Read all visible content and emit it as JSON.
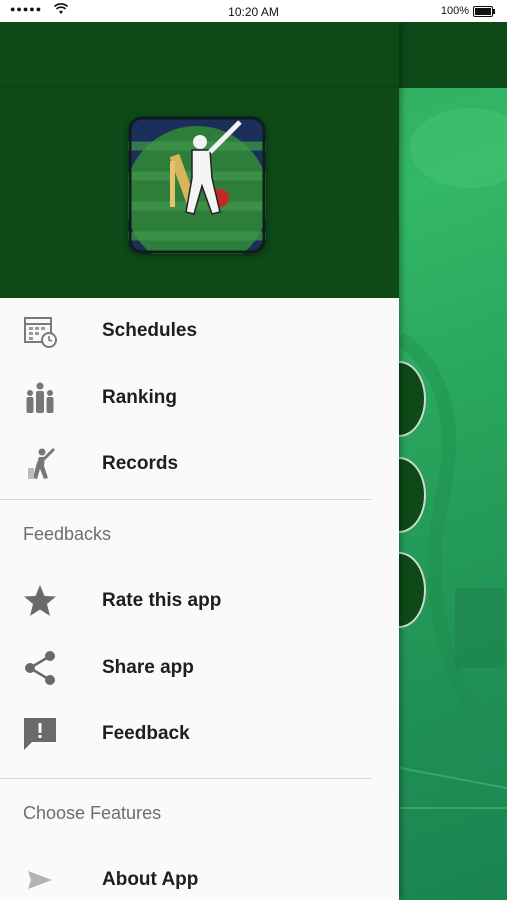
{
  "status_bar": {
    "signal": "●●●●●",
    "time": "10:20 AM",
    "battery": "100%"
  },
  "drawer": {
    "main_items": [
      {
        "label": "Schedules",
        "icon": "calendar-clock-icon"
      },
      {
        "label": "Ranking",
        "icon": "ranking-people-icon"
      },
      {
        "label": "Records",
        "icon": "batsman-icon"
      }
    ],
    "feedback_section": {
      "title": "Feedbacks",
      "items": [
        {
          "label": "Rate this app",
          "icon": "star-icon"
        },
        {
          "label": "Share app",
          "icon": "share-icon"
        },
        {
          "label": "Feedback",
          "icon": "feedback-icon"
        }
      ]
    },
    "features_section": {
      "title": "Choose Features",
      "items": [
        {
          "label": "About App",
          "icon": "send-icon"
        }
      ]
    }
  },
  "colors": {
    "header_green": "#0d4a18",
    "background_green": "#2ea85a",
    "icon_gray": "#6f6f6f"
  }
}
